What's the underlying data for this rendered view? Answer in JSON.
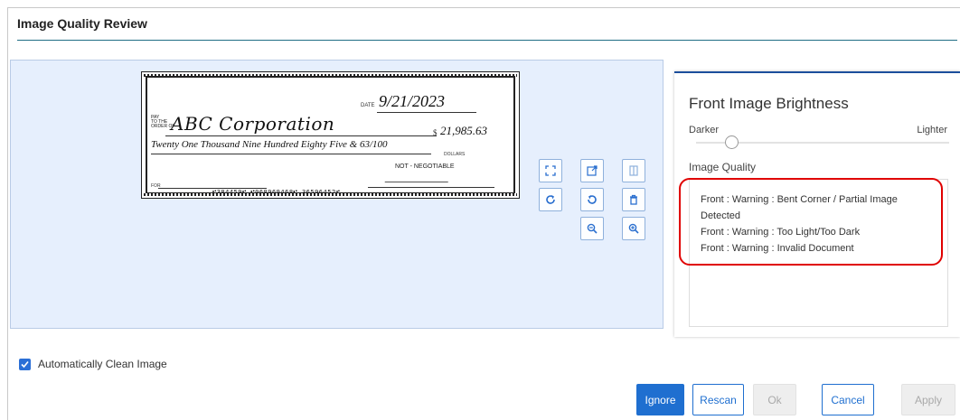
{
  "header": {
    "title": "Image Quality Review"
  },
  "check": {
    "pay_to": "PAY\nTO THE\nORDER OF",
    "payee": "ABC Corporation",
    "date_label": "DATE",
    "date": "9/21/2023",
    "amount_sign": "$",
    "amount": "21,985.63",
    "amount_words": "Twenty One Thousand Nine Hundred Eighty Five & 63/100",
    "dollars_label": "DOLLARS",
    "non_negotiable": "NOT - NEGOTIABLE",
    "for_label": "FOR",
    "micr": "⑈384459⑈  ⑆068969468⑆  36596452⑈"
  },
  "toolbar": {
    "tools": [
      {
        "name": "fit-icon"
      },
      {
        "name": "open-external-icon"
      },
      {
        "name": "split-view-icon"
      },
      {
        "name": "rotate-right-icon"
      },
      {
        "name": "undo-icon"
      },
      {
        "name": "delete-icon"
      },
      {
        "name": "zoom-out-icon"
      },
      {
        "name": "zoom-in-icon"
      }
    ]
  },
  "brightness": {
    "title": "Front Image Brightness",
    "darker_label": "Darker",
    "lighter_label": "Lighter",
    "value": 0.14
  },
  "image_quality": {
    "label": "Image Quality",
    "messages": [
      "Front : Warning : Bent Corner / Partial Image Detected",
      "Front : Warning : Too Light/Too Dark",
      "Front : Warning : Invalid Document"
    ]
  },
  "auto_clean": {
    "label": "Automatically Clean Image",
    "checked": true
  },
  "buttons": {
    "ignore": "Ignore",
    "rescan": "Rescan",
    "ok": "Ok",
    "cancel": "Cancel",
    "apply": "Apply"
  },
  "colors": {
    "primary": "#1f6fd0",
    "viewer_bg": "#e6effd",
    "highlight": "#e00000",
    "panel_accent": "#1c4f9c"
  }
}
